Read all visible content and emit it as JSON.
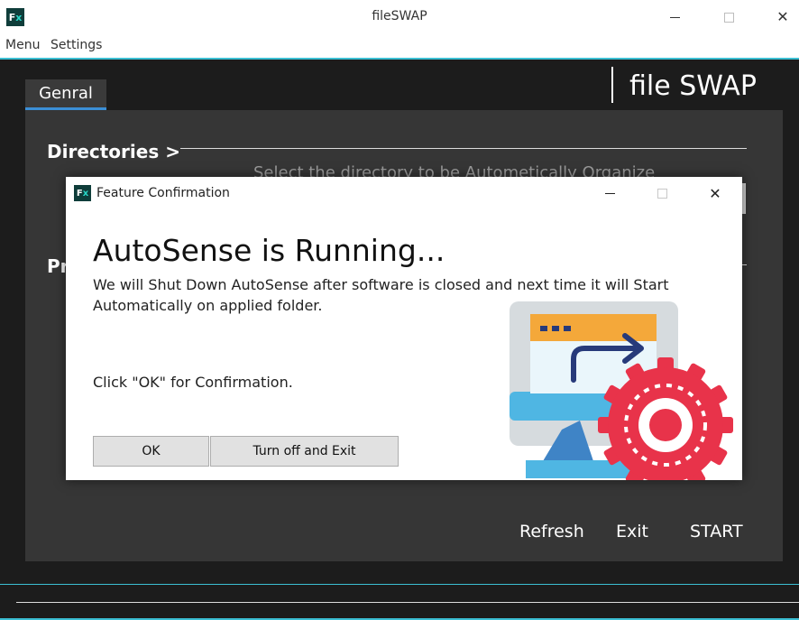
{
  "window": {
    "title": "fileSWAP",
    "logo": "Fx"
  },
  "menu": {
    "items": [
      "Menu",
      "Settings"
    ]
  },
  "tabs": [
    {
      "label": "Genral"
    }
  ],
  "brand": "file SWAP",
  "sections": {
    "directories": "Directories  >",
    "p_fragment": "Pr"
  },
  "hint": "Select the directory to be Autometically Organize",
  "footer": {
    "refresh": "Refresh",
    "exit": "Exit",
    "start": "START"
  },
  "dialog": {
    "title": "Feature Confirmation",
    "heading": "AutoSense is Running...",
    "message": "We will Shut Down AutoSense after software is closed and next time it will Start Automatically on applied folder.",
    "confirm_text": "Click \"OK\" for Confirmation.",
    "ok_label": "OK",
    "turn_off_label": "Turn off and Exit",
    "illustration": "window-with-gear-icon"
  },
  "colors": {
    "accent": "#3bbfd3",
    "tab_underline": "#3b8fd6",
    "gear": "#e8334a",
    "dark_bg": "#1c1c1c",
    "panel": "#363636"
  }
}
